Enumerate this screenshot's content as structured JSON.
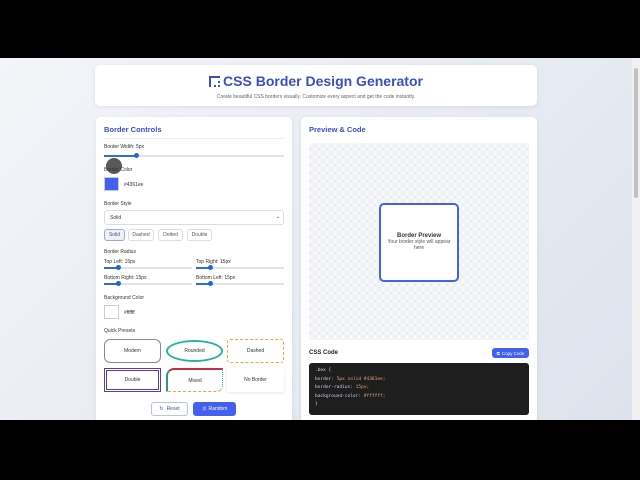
{
  "header": {
    "title": "CSS Border Design Generator",
    "subtitle": "Create beautiful CSS borders visually. Customize every aspect and get the code instantly."
  },
  "controls": {
    "title": "Border Controls",
    "border_width_label": "Border Width: 5px",
    "border_width_value": 5,
    "border_color_label": "Border Color",
    "border_color_value": "#4361ee",
    "border_style_label": "Border Style",
    "border_style_selected": "Solid",
    "style_buttons": [
      "Solid",
      "Dashed",
      "Dotted",
      "Double"
    ],
    "style_active": "Solid",
    "radius_label": "Border Radius",
    "radius": [
      {
        "label": "Top Left: 15px",
        "value": 15
      },
      {
        "label": "Top Right: 15px",
        "value": 15
      },
      {
        "label": "Bottom Right: 15px",
        "value": 15
      },
      {
        "label": "Bottom Left: 15px",
        "value": 15
      }
    ],
    "bg_label": "Background Color",
    "bg_value": "#ffffff",
    "presets_label": "Quick Presets",
    "presets": [
      "Modern",
      "Rounded",
      "Dashed",
      "Double",
      "Mixed",
      "No Border"
    ],
    "reset": "Reset",
    "random": "Random"
  },
  "preview": {
    "title": "Preview & Code",
    "box_title": "Border Preview",
    "box_text": "Your border style will appear here",
    "css_label": "CSS Code",
    "copy": "Copy Code",
    "code": {
      "selector": ".box {",
      "l1k": "border:",
      "l1v": "5px solid #4361ee;",
      "l2k": "border-radius:",
      "l2v": "15px;",
      "l3k": "background-color:",
      "l3v": "#ffffff;",
      "close": "}"
    }
  },
  "colors": {
    "accent": "#4361ee",
    "title": "#3b4fc4"
  }
}
